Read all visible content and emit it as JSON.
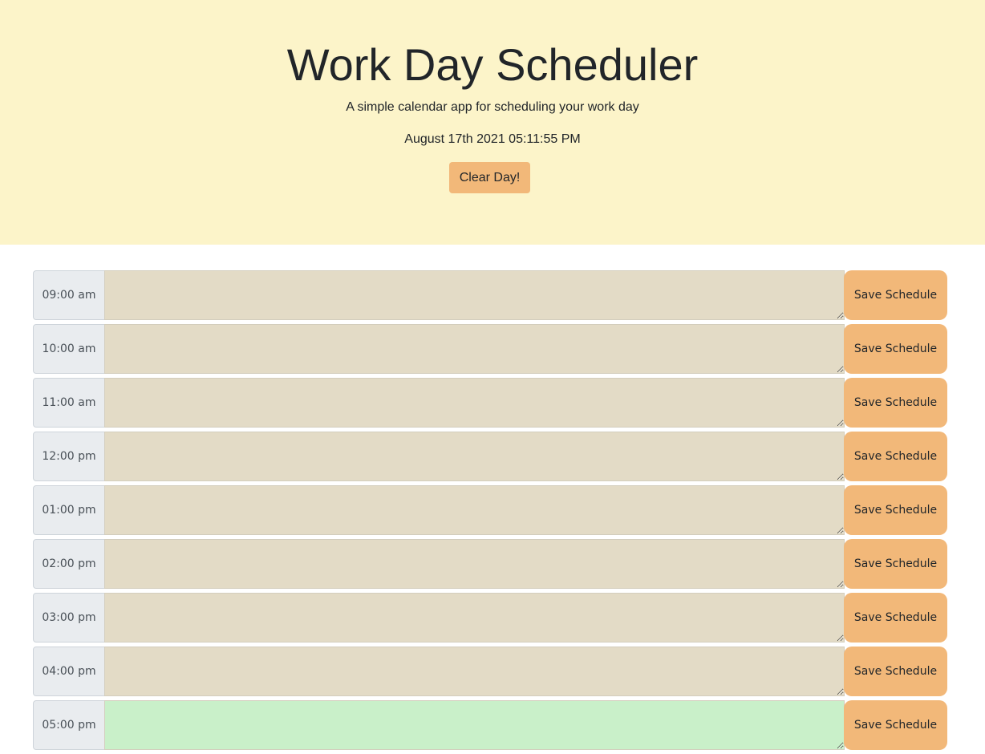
{
  "header": {
    "title": "Work Day Scheduler",
    "lead": "A simple calendar app for scheduling your work day",
    "current_datetime": "August 17th 2021 05:11:55 PM",
    "clear_label": "Clear Day!"
  },
  "schedule": {
    "save_label": "Save Schedule",
    "rows": [
      {
        "hour": "09:00 am",
        "text": "",
        "state": "past"
      },
      {
        "hour": "10:00 am",
        "text": "",
        "state": "past"
      },
      {
        "hour": "11:00 am",
        "text": "",
        "state": "past"
      },
      {
        "hour": "12:00 pm",
        "text": "",
        "state": "past"
      },
      {
        "hour": "01:00 pm",
        "text": "",
        "state": "past"
      },
      {
        "hour": "02:00 pm",
        "text": "",
        "state": "past"
      },
      {
        "hour": "03:00 pm",
        "text": "",
        "state": "past"
      },
      {
        "hour": "04:00 pm",
        "text": "",
        "state": "past"
      },
      {
        "hour": "05:00 pm",
        "text": "",
        "state": "present"
      }
    ]
  },
  "colors": {
    "header_background": "#fcf4c9",
    "accent": "#f2b879",
    "past": "#e3dbc6",
    "present": "#c9f0c9"
  }
}
